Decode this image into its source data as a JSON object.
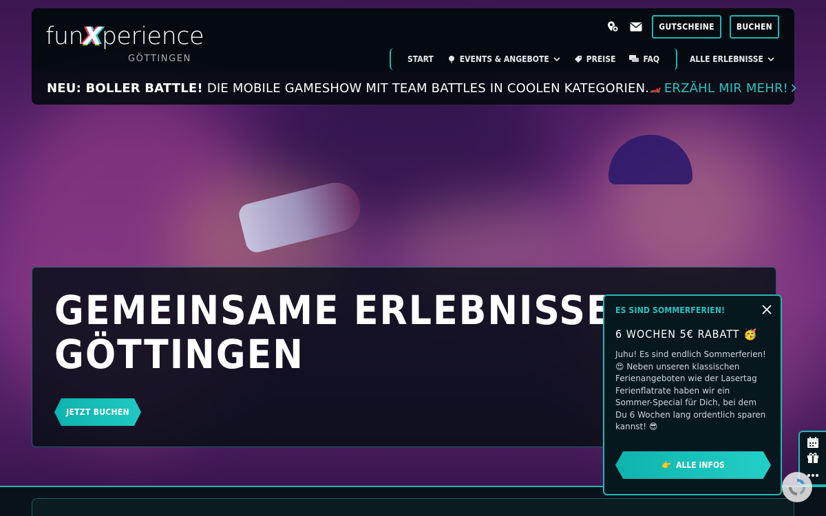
{
  "brand": {
    "logo_fun": "fun",
    "logo_x": "X",
    "logo_perience": "perience",
    "logo_city": "GÖTTINGEN",
    "accent_color": "#1fb9b4"
  },
  "header": {
    "util_icons": [
      "location-icon",
      "mail-icon"
    ],
    "vouchers_label": "GUTSCHEINE",
    "book_label": "BUCHEN"
  },
  "nav": {
    "start": "START",
    "events": "EVENTS & ANGEBOTE",
    "prices": "PREISE",
    "faq": "FAQ",
    "all_experiences": "ALLE ERLEBNISSE"
  },
  "announcement": {
    "bold": "NEU: BOLLER BATTLE!",
    "text": "DIE MOBILE GAMESHOW MIT TEAM BATTLES IN COOLEN KATEGORIEN.",
    "link_emoji": "🏎️",
    "link_label": "ERZÄHL MIR MEHR!"
  },
  "hero": {
    "title": "GEMEINSAME ERLEBNISSE IN GÖTTINGEN",
    "cta_label": "JETZT BUCHEN"
  },
  "popup": {
    "eyebrow": "ES SIND SOMMERFERIEN!",
    "title": "6 WOCHEN 5€ RABATT 🥳",
    "body": "Juhu! Es sind endlich Sommerferien! 😍 Neben unseren klassischen Ferienangeboten wie der Lasertag Ferienflatrate haben wir ein Sommer-Special für Dich, bei dem Du 6 Wochen lang ordentlich sparen kannst! 😎",
    "cta_emoji": "👉",
    "cta_label": "ALLE INFOS"
  },
  "side_dock": {
    "icons": [
      "calendar-icon",
      "gift-icon",
      "more-icon"
    ]
  }
}
